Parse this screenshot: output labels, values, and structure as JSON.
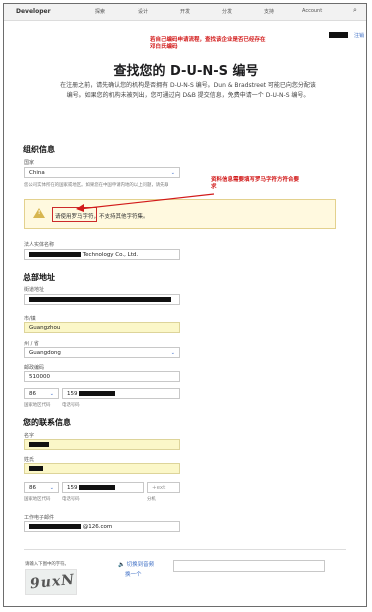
{
  "nav": {
    "logo": "Developer",
    "items": [
      "探索",
      "设计",
      "开发",
      "分发",
      "支持",
      "Account"
    ],
    "signout": "注销"
  },
  "annotations": {
    "top": "若自己编码申请流程，查找该企业是否已经存在邓白氏编码",
    "middle": "资料信息需要填写罗马字符方符合要求"
  },
  "page": {
    "title": "查找您的 D-U-N-S 编号",
    "intro": "在注册之前，请先确认您的机构是否拥有 D-U-N-S 编号。Dun & Bradstreet 可能已向您分配该编号。如果您的机构未被列出，您可通过向 D&B 提交信息，免费申请一个 D-U-N-S 编号。"
  },
  "org": {
    "section": "组织信息",
    "country_label": "国家",
    "country_value": "China",
    "country_hint": "您公司实体所在的国家或地区。如果您在中国申请内地的以上问题，请先联系我们。",
    "warning_text": "请使用罗马字符，不支持其他字符集。",
    "legal_name_label": "法人实体名称",
    "legal_name_value": "Technology Co., Ltd."
  },
  "hq": {
    "section": "总部地址",
    "street_label": "街道地址",
    "city_label": "市/镇",
    "city_value": "Guangzhou",
    "state_label": "州 / 省",
    "state_value": "Guangdong",
    "zip_label": "邮政编码",
    "zip_value": "510000",
    "country_code": "86",
    "phone_prefix": "159",
    "country_code_label": "国家地区代码",
    "phone_label": "电话号码"
  },
  "contact": {
    "section": "您的联系信息",
    "first_name_label": "名字",
    "last_name_label": "姓氏",
    "country_code": "86",
    "phone_prefix": "159",
    "extension_placeholder": "+ext",
    "country_code_label": "国家地区代码",
    "phone_label": "电话号码",
    "extension_label": "分机",
    "email_label": "工作电子邮件",
    "email_suffix": "@126.com"
  },
  "captcha": {
    "label": "请输入下图中的字符。",
    "audio_link": "切换到音频",
    "refresh_link": "换一个",
    "image_text": "9uxN"
  }
}
